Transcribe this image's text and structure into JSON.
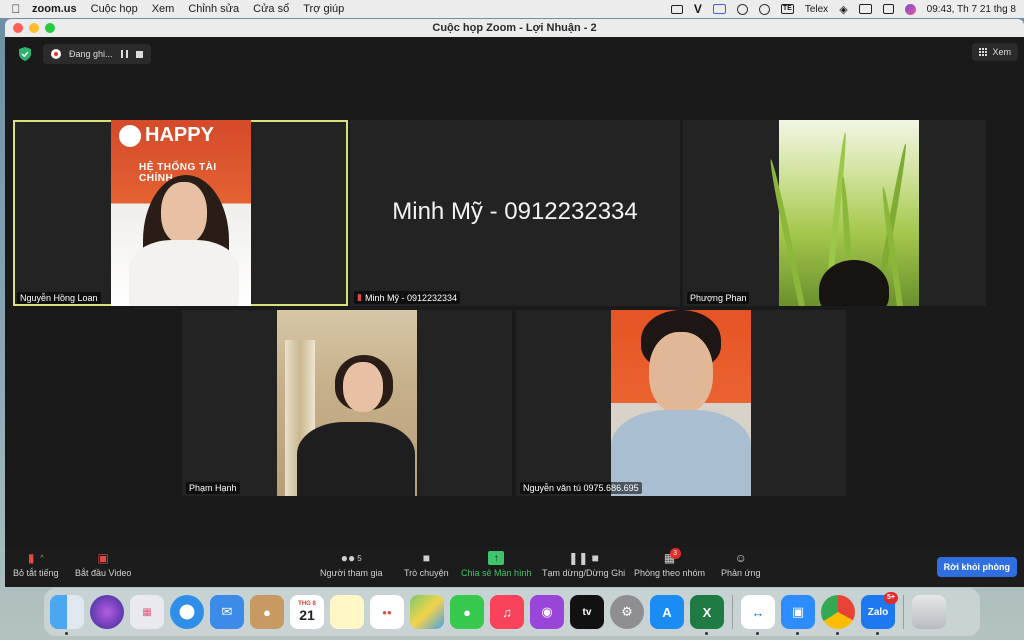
{
  "menubar": {
    "app_name": "zoom.us",
    "menus": [
      "Cuộc họp",
      "Xem",
      "Chỉnh sửa",
      "Cửa sổ",
      "Trợ giúp"
    ],
    "input_source": "Telex",
    "clock": "09:43, Th 7 21 thg 8"
  },
  "window": {
    "title": "Cuộc họp Zoom - Lợi Nhuận - 2"
  },
  "recording": {
    "status": "Đang ghi..."
  },
  "view_button": {
    "label": "Xem"
  },
  "participants": [
    {
      "name": "Nguyễn Hồng Loan",
      "video_on": true,
      "active_speaker": true,
      "logo_text": "HAPPY",
      "sign_text": "HỆ THỐNG TÀI CHÍNH"
    },
    {
      "name": "Minh Mỹ - 0912232334",
      "video_on": false,
      "muted": true
    },
    {
      "name": "Phượng Phan",
      "video_on": true
    },
    {
      "name": "Phạm Hạnh",
      "video_on": true
    },
    {
      "name": "Nguyễn văn tú 0975.686.695",
      "video_on": true
    }
  ],
  "toolbar": {
    "mute_label": "Bỏ tắt tiếng",
    "video_label": "Bắt đầu Video",
    "participants_label": "Người tham gia",
    "participants_count": "5",
    "chat_label": "Trò chuyện",
    "share_label": "Chia sẻ Màn hình",
    "pause_label": "Tạm dừng/Dừng Ghi",
    "breakout_label": "Phòng theo nhóm",
    "breakout_badge": "3",
    "reactions_label": "Phản ứng",
    "leave_label": "Rời khỏi phòng"
  },
  "dock": {
    "calendar_month": "THG 8",
    "calendar_day": "21",
    "zalo_label": "Zalo",
    "zalo_badge": "5+",
    "tv_label": "tv"
  },
  "colors": {
    "active_speaker_outline": "#d9e27a",
    "share_green": "#3ec46d",
    "leave_blue": "#2f6fe0",
    "muted_red": "#e14848"
  }
}
